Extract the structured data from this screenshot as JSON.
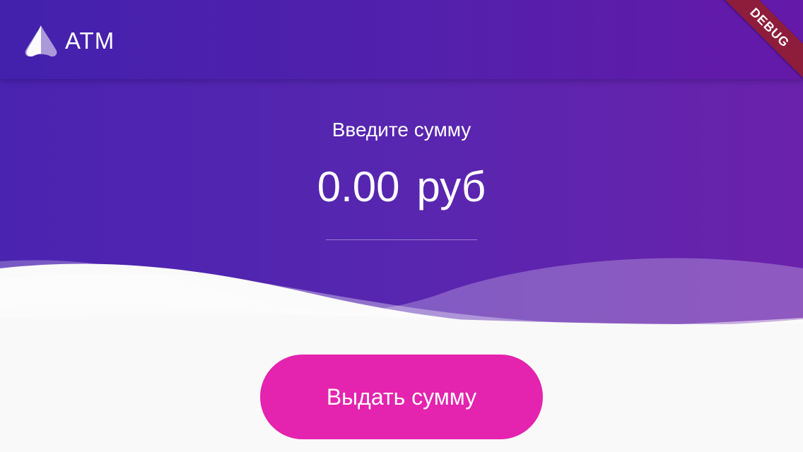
{
  "app": {
    "logo_text": "ATM",
    "logo_icon": "atm-logo-icon"
  },
  "debug_banner": {
    "label": "DEBUG"
  },
  "amount_entry": {
    "label": "Введите сумму",
    "value": "0.00",
    "currency": "руб"
  },
  "actions": {
    "withdraw_label": "Выдать сумму"
  },
  "colors": {
    "header_gradient_start": "#4321ad",
    "header_gradient_end": "#6519a9",
    "button": "#e423ae",
    "debug_ribbon": "#8e1d3c",
    "background": "#f9f9f9"
  }
}
